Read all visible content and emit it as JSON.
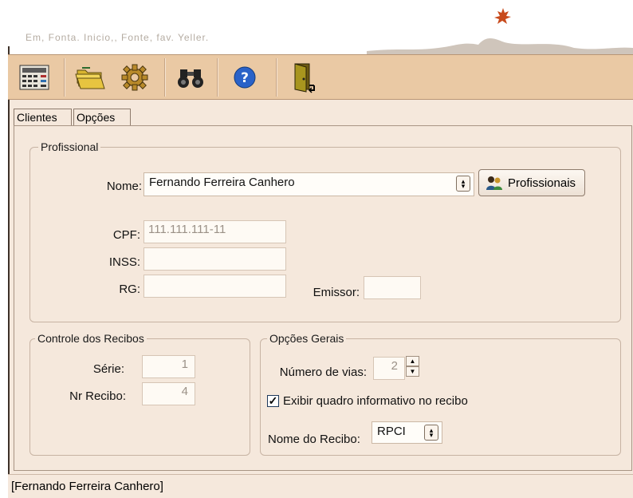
{
  "window": {
    "faded_title": "Em, Fonta. Inicio,, Fonte, fav. Yeller."
  },
  "toolbar": {
    "buttons": [
      {
        "icon": "calculator-icon"
      },
      {
        "icon": "folders-icon"
      },
      {
        "icon": "gear-icon"
      },
      {
        "icon": "binoculars-icon"
      },
      {
        "icon": "help-icon"
      },
      {
        "icon": "exit-door-icon"
      }
    ]
  },
  "tabs": [
    {
      "label": "Clientes"
    },
    {
      "label": "Opções"
    }
  ],
  "profissional": {
    "title": "Profissional",
    "nome_label": "Nome:",
    "nome_value": "Fernando Ferreira Canhero",
    "profissionais_button": "Profissionais",
    "cpf_label": "CPF:",
    "cpf_value": "111.111.111-11",
    "inss_label": "INSS:",
    "inss_value": "",
    "rg_label": "RG:",
    "rg_value": "",
    "emissor_label": "Emissor:",
    "emissor_value": ""
  },
  "controle": {
    "title": "Controle dos Recibos",
    "serie_label": "Série:",
    "serie_value": "1",
    "recibo_label": "Nr Recibo:",
    "recibo_value": "4"
  },
  "opcoes": {
    "title": "Opções Gerais",
    "vias_label": "Número de vias:",
    "vias_value": "2",
    "exibir_label": "Exibir quadro informativo no recibo",
    "exibir_checked": true,
    "nome_recibo_label": "Nome do Recibo:",
    "nome_recibo_value": "RPCI"
  },
  "status": {
    "text": "[Fernando Ferreira Canhero]"
  },
  "colors": {
    "toolbar_bg": "#eac9a4",
    "panel_bg": "#f5e8dc",
    "field_bg": "#fefaf4"
  }
}
